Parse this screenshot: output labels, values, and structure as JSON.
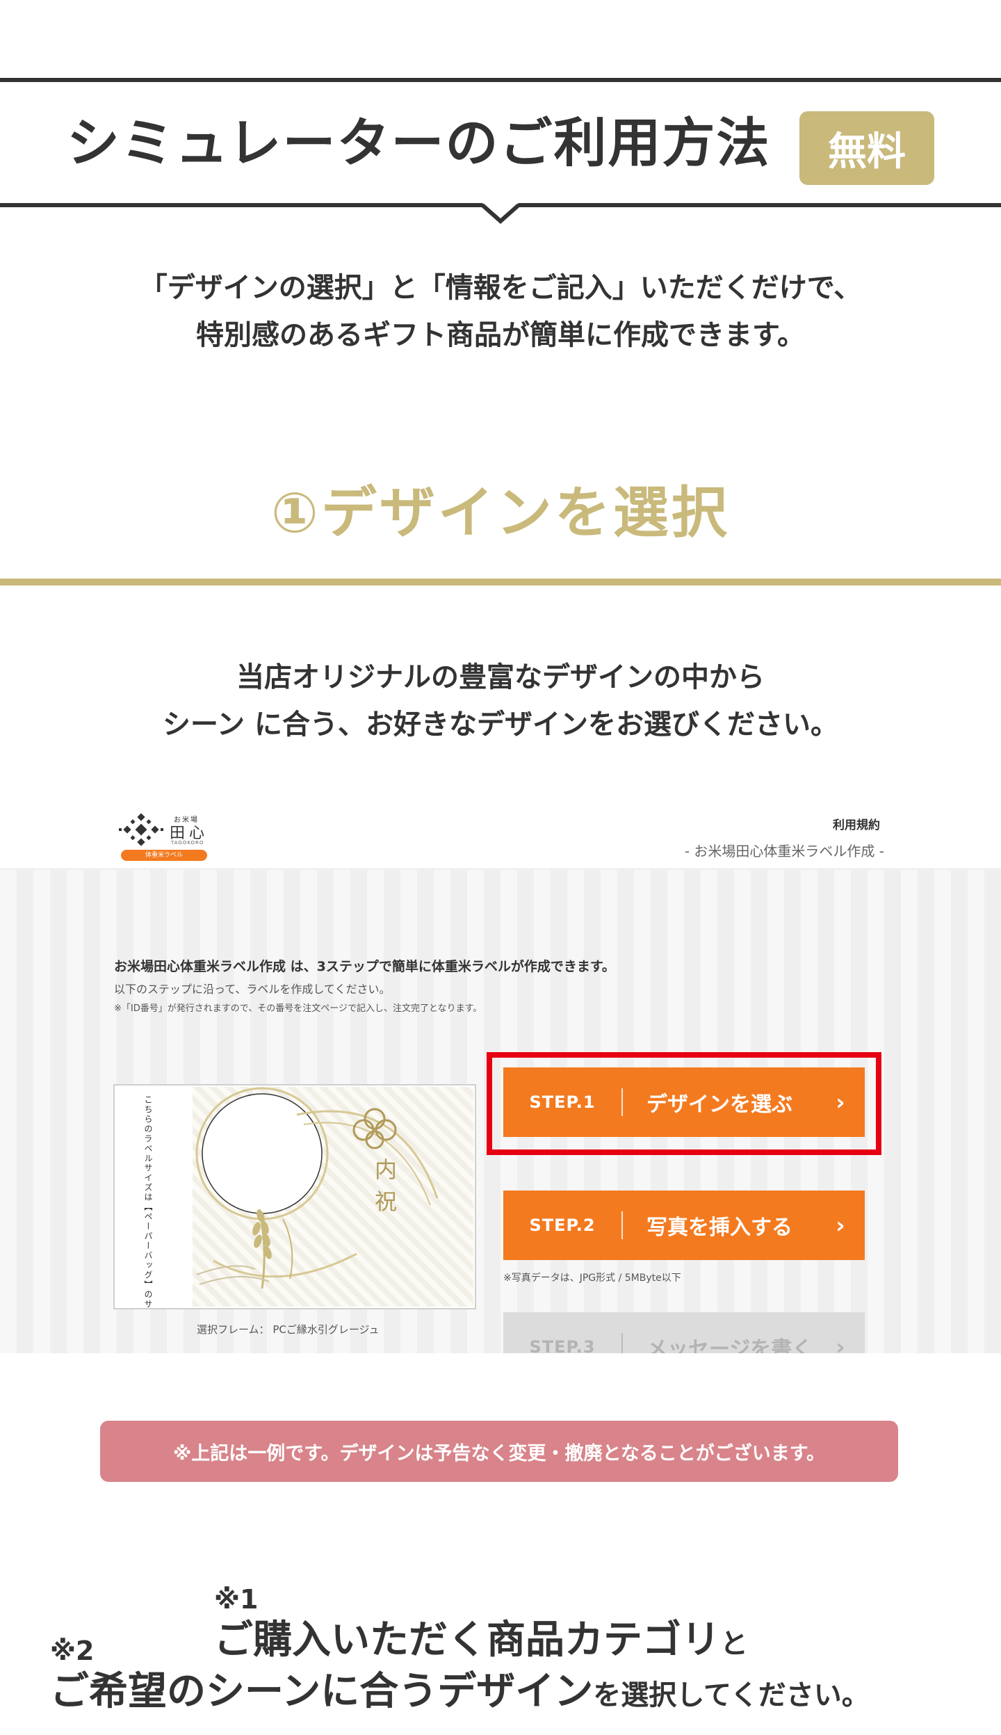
{
  "header": {
    "title": "シミュレーターのご利用方法",
    "badge": "無料"
  },
  "intro": {
    "line1": "「デザインの選択」と「情報をご記入」いただくだけで、",
    "line2": "特別感のあるギフト商品が簡単に作成できます。"
  },
  "step_section": {
    "title": "①デザインを選択",
    "line1": "当店オリジナルの豊富なデザインの中から",
    "line2": "シーン に合う、お好きなデザインをお選びください。"
  },
  "screenshot": {
    "logo": {
      "small": "お米場",
      "name": "田心",
      "sub": "TAGOKORO",
      "pill": "体重米ラベル"
    },
    "terms_link": "利用規約",
    "subtitle": "- お米場田心体重米ラベル作成 -",
    "lead_bold": "お米場田心体重米ラベル作成 は、3ステップで簡単に体重米ラベルが作成できます。",
    "lead_2": "以下のステップに沿って、ラベルを作成してください。",
    "lead_3": "※「ID番号」が発行されますので、その番号を注文ページで記入し、注文完了となります。",
    "label_vertical": "こちらのラベルサイズは【ペーパーバッグ】のサイズとなります。",
    "label_kanji": "内祝",
    "frame_caption": "選択フレーム： PCご縁水引グレージュ",
    "steps": [
      {
        "no": "STEP.1",
        "label": "デザインを選ぶ",
        "arrow": "›",
        "enabled": true
      },
      {
        "no": "STEP.2",
        "label": "写真を挿入する",
        "arrow": "›",
        "enabled": true
      },
      {
        "no": "STEP.3",
        "label": "メッセージを書く",
        "arrow": "›",
        "enabled": false
      }
    ],
    "photo_note": "※写真データは、JPG形式 / 5MByte以下",
    "colors": {
      "orange": "#f47a20",
      "highlight": "#e60012",
      "gold": "#c9b97b"
    }
  },
  "notice": "※上記は一例です。デザインは予告なく変更・撤廃となることがございます。",
  "bottom": {
    "note1": "※1",
    "line1_main": "ご購入いただく商品カテゴリ",
    "line1_tail": "と",
    "note2": "※2",
    "line2_main": "ご希望のシーンに合うデザイン",
    "line2_tail": "を選択してください。"
  }
}
